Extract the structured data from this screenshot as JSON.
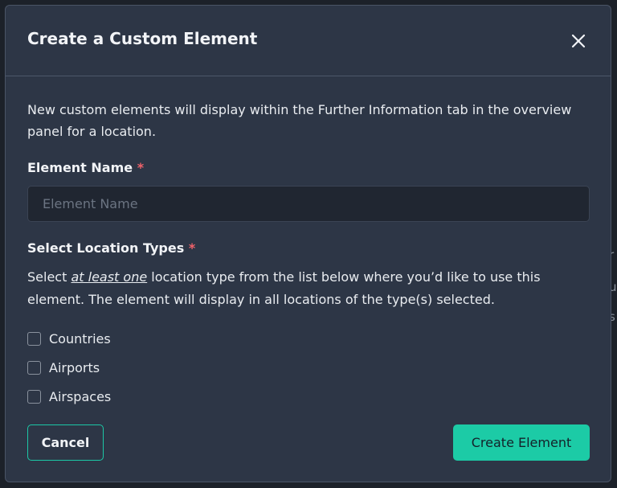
{
  "modal": {
    "title": "Create a Custom Element",
    "close_icon": "close-icon",
    "description": "New custom elements will display within the Further Information tab in the overview panel for a location."
  },
  "element_name": {
    "label": "Element Name",
    "required_marker": "*",
    "placeholder": "Element Name",
    "value": ""
  },
  "location_types": {
    "label": "Select Location Types",
    "required_marker": "*",
    "desc_prefix": "Select ",
    "desc_emphasis": "at least one",
    "desc_suffix": " location type from the list below where you’d like to use this element. The element will display in all locations of the type(s) selected.",
    "options": [
      {
        "label": "Countries",
        "checked": false
      },
      {
        "label": "Airports",
        "checked": false
      },
      {
        "label": "Airspaces",
        "checked": false
      }
    ]
  },
  "actions": {
    "cancel_label": "Cancel",
    "create_label": "Create Element"
  },
  "background": {
    "glyphs": [
      "r",
      "u",
      "s"
    ]
  },
  "colors": {
    "accent": "#1ccba6",
    "required": "#f0626a",
    "modal_bg": "#2d3646"
  }
}
